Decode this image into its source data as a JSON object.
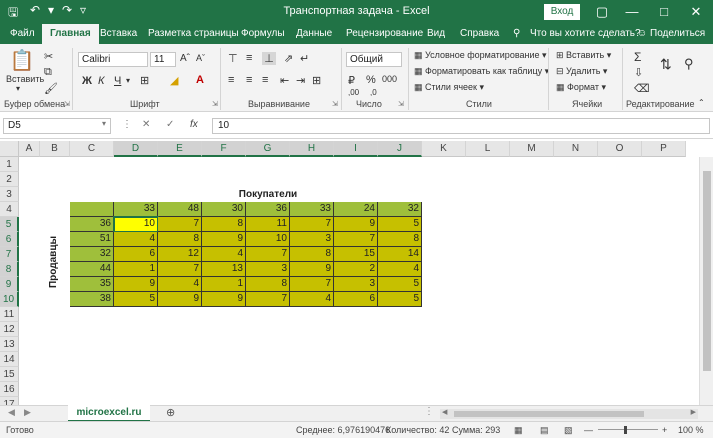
{
  "title_bar": {
    "title": "Транспортная задача  -  Excel",
    "sign_in": "Вход",
    "save_icon": "save-icon",
    "undo_icon": "undo-icon",
    "redo_icon": "redo-icon"
  },
  "menu": {
    "tabs": [
      "Файл",
      "Главная",
      "Вставка",
      "Разметка страницы",
      "Формулы",
      "Данные",
      "Рецензирование",
      "Вид",
      "Справка"
    ],
    "active": "Главная",
    "tell_me": "Что вы хотите сделать?",
    "share": "Поделиться"
  },
  "ribbon": {
    "clipboard": {
      "paste": "Вставить",
      "label": "Буфер обмена"
    },
    "font": {
      "name": "Calibri",
      "size": "11",
      "label": "Шрифт",
      "bold": "Ж",
      "italic": "К",
      "underline": "Ч"
    },
    "alignment": {
      "label": "Выравнивание"
    },
    "number": {
      "format": "Общий",
      "label": "Число"
    },
    "styles": {
      "conditional": "Условное форматирование",
      "table": "Форматировать как таблицу",
      "cell_styles": "Стили ячеек",
      "label": "Стили"
    },
    "cells": {
      "insert": "Вставить",
      "delete": "Удалить",
      "format": "Формат",
      "label": "Ячейки"
    },
    "editing": {
      "label": "Редактирование"
    }
  },
  "formula_bar": {
    "name_box": "D5",
    "fx": "fx",
    "value": "10"
  },
  "sheet": {
    "columns": [
      "A",
      "B",
      "C",
      "D",
      "E",
      "F",
      "G",
      "H",
      "I",
      "J",
      "K",
      "L",
      "M",
      "N",
      "O",
      "P"
    ],
    "rows": [
      "1",
      "2",
      "3",
      "4",
      "5",
      "6",
      "7",
      "8",
      "9",
      "10",
      "11",
      "12",
      "13",
      "14",
      "15",
      "16",
      "17"
    ],
    "buyers_title": "Покупатели",
    "sellers_title": "Продавцы",
    "demand": [
      "33",
      "48",
      "30",
      "36",
      "33",
      "24",
      "32"
    ],
    "supply": [
      "36",
      "51",
      "32",
      "44",
      "35",
      "38"
    ],
    "costs": [
      [
        "10",
        "7",
        "8",
        "11",
        "7",
        "9",
        "5"
      ],
      [
        "4",
        "8",
        "9",
        "10",
        "3",
        "7",
        "8"
      ],
      [
        "6",
        "12",
        "4",
        "7",
        "8",
        "15",
        "14"
      ],
      [
        "1",
        "7",
        "13",
        "3",
        "9",
        "2",
        "4"
      ],
      [
        "9",
        "4",
        "1",
        "8",
        "7",
        "3",
        "5"
      ],
      [
        "5",
        "9",
        "9",
        "7",
        "4",
        "6",
        "5"
      ]
    ],
    "colors": {
      "header_green": "#9fbf3b",
      "cost_yellow": "#c6c000",
      "active_cell": "#ffff00",
      "excel_green": "#217346"
    }
  },
  "sheet_tabs": {
    "active": "microexcel.ru"
  },
  "status_bar": {
    "ready": "Готово",
    "average": "Среднее: 6,976190476",
    "count": "Количество: 42",
    "sum": "Сумма: 293",
    "zoom": "100 %"
  }
}
